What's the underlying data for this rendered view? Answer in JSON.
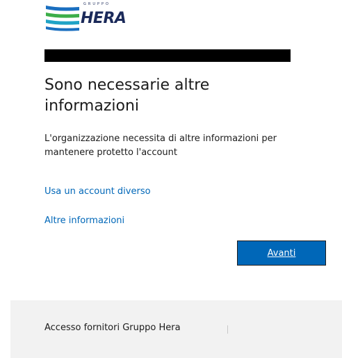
{
  "logo": {
    "group_text": "GRUPPO",
    "brand_text": "HERA",
    "colors": {
      "navy": "#1b2a5a",
      "blue": "#1a6fc0",
      "green": "#3cae49",
      "teal": "#1fa3c6"
    }
  },
  "account": {
    "redacted": true
  },
  "main": {
    "title": "Sono necessarie altre informazioni",
    "description": "L'organizzazione necessita di altre informazioni per mantenere protetto l'account",
    "other_account_link": "Usa un account diverso",
    "more_info_link": "Altre informazioni",
    "next_button": "Avanti"
  },
  "footer": {
    "text": "Accesso fornitori Gruppo Hera"
  },
  "colors": {
    "link": "#0067b8",
    "button_bg": "#0067b8",
    "footer_bg": "#f2f2f2",
    "text": "#1b1b1b"
  }
}
